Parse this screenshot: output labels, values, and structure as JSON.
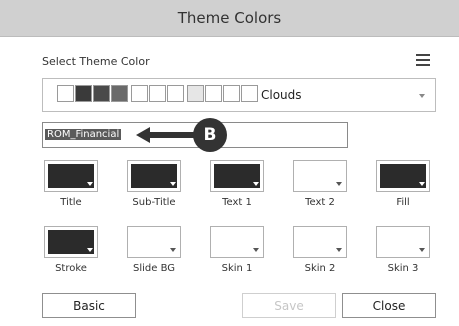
{
  "dialog": {
    "title": "Theme Colors"
  },
  "section_label": "Select Theme Color",
  "theme": {
    "name": "Clouds",
    "swatch_colors": [
      "#ffffff",
      "#3a3a3a",
      "#4a4a4a",
      "#6a6a6a",
      "#ffffff",
      "#ffffff",
      "#ffffff",
      "#e6e6e6",
      "#ffffff",
      "#ffffff",
      "#ffffff"
    ]
  },
  "name_field": {
    "value": "ROM_Financial"
  },
  "callout": {
    "label": "B"
  },
  "colors": [
    {
      "label": "Title",
      "color": "#2b2b2b",
      "dark": true
    },
    {
      "label": "Sub-Title",
      "color": "#2b2b2b",
      "dark": true
    },
    {
      "label": "Text 1",
      "color": "#2b2b2b",
      "dark": true
    },
    {
      "label": "Text 2",
      "color": "#ffffff",
      "dark": false
    },
    {
      "label": "Fill",
      "color": "#2b2b2b",
      "dark": true
    },
    {
      "label": "Stroke",
      "color": "#2b2b2b",
      "dark": true
    },
    {
      "label": "Slide BG",
      "color": "#ffffff",
      "dark": false
    },
    {
      "label": "Skin 1",
      "color": "#ffffff",
      "dark": false
    },
    {
      "label": "Skin 2",
      "color": "#ffffff",
      "dark": false
    },
    {
      "label": "Skin 3",
      "color": "#ffffff",
      "dark": false
    }
  ],
  "buttons": {
    "basic": "Basic",
    "save": "Save",
    "close": "Close"
  }
}
